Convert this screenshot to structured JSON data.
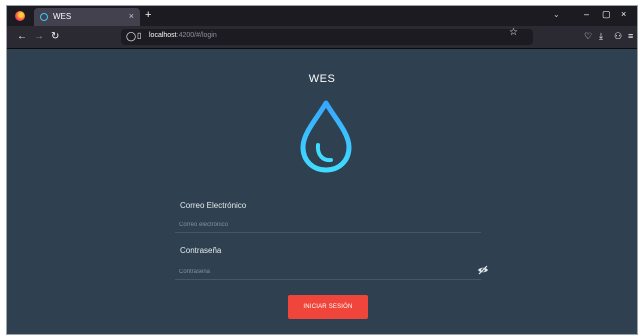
{
  "browser": {
    "tab_title": "WES",
    "tab_close": "×",
    "new_tab": "+",
    "tab_list": "⌄",
    "window_controls": [
      "–",
      "▢",
      "×"
    ],
    "url_host": "localhost",
    "url_rest": ":4200/#/login"
  },
  "app": {
    "title": "WES",
    "accent_color": "#3cc8ff"
  },
  "form": {
    "email_label": "Correo Electrónico",
    "email_placeholder": "Correo electrónico",
    "email_value": "",
    "password_label": "Contraseña",
    "password_placeholder": "Contraseña",
    "password_value": "",
    "submit_label": "INICIAR SESIÓN",
    "submit_color": "#f0453a"
  }
}
